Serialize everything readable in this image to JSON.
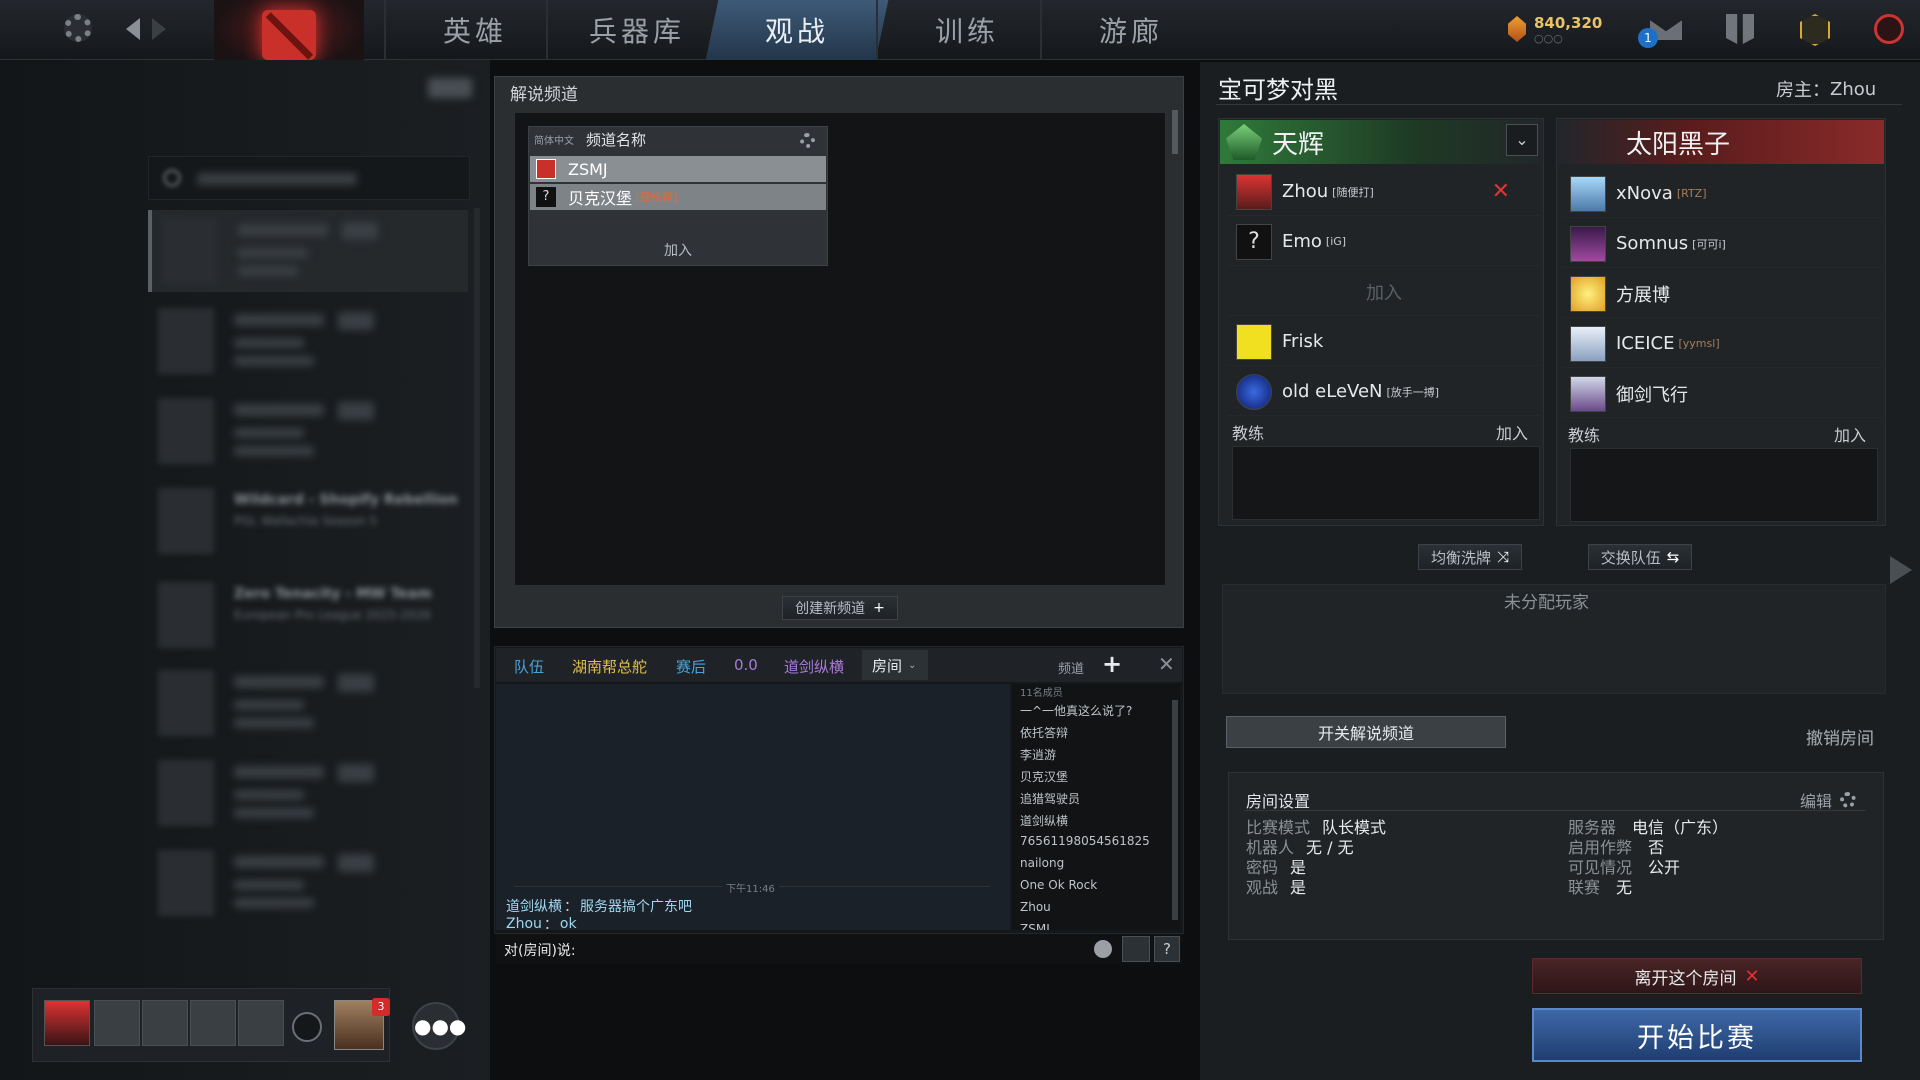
{
  "topbar": {
    "tabs": [
      "英雄",
      "兵器库",
      "观战",
      "训练",
      "游廊"
    ],
    "active_tab": "观战",
    "currency": "840,320",
    "currency_sub": "○○○",
    "notif_count": "1"
  },
  "left_panel": {
    "toggle_label": "▮▮",
    "search_placeholder": "",
    "blurred_title_1": "Wildcard - Shopify Rebellion",
    "blurred_sub_1": "PGL Wallachia Season 5",
    "blurred_title_2": "Zero Tenacity - MW Team",
    "blurred_sub_2": "European Pro League 2025-2026"
  },
  "caster_channel": {
    "title": "解说频道",
    "lang_label": "简体中文",
    "col_header": "频道名称",
    "channels": [
      {
        "name": "ZSMJ",
        "tag": ""
      },
      {
        "name": "贝克汉堡",
        "tag": "[硬核帮]"
      }
    ],
    "join_label": "加入",
    "create_label": "创建新频道"
  },
  "chat": {
    "tabs": [
      "队伍",
      "湖南帮总舵",
      "赛后",
      "0.0",
      "道剑纵横",
      "房间"
    ],
    "channel_label": "频道",
    "member_count": "11名成员",
    "members": [
      "一^一他真这么说了?",
      "依托答辩",
      "李逍游",
      "贝克汉堡",
      "追猎驾驶员",
      "道剑纵横",
      "76561198054561825",
      "nailong",
      "One Ok Rock",
      "Zhou",
      "ZSMJ"
    ],
    "time": "下午11:46",
    "messages": [
      {
        "from": "道剑纵横",
        "sep": "：",
        "text": "服务器搞个广东吧"
      },
      {
        "from": "Zhou",
        "sep": "：",
        "text": "ok"
      }
    ],
    "input_label": "对(房间)说:",
    "help": "?"
  },
  "lobby": {
    "title": "宝可梦对黑",
    "host_label": "房主：",
    "host": "Zhou",
    "radiant": {
      "name": "天辉",
      "players": [
        {
          "name": "Zhou",
          "tag": "[随便打]"
        },
        {
          "name": "Emo",
          "tag": "[iG]"
        },
        {
          "name": "加入",
          "tag": ""
        },
        {
          "name": "Frisk",
          "tag": ""
        },
        {
          "name": "old eLeVeN",
          "tag": "[放手一搏]"
        }
      ],
      "coach_label": "教练",
      "coach_join": "加入"
    },
    "dire": {
      "name": "太阳黑子",
      "players": [
        {
          "name": "xNova",
          "tag": "[RTZ]"
        },
        {
          "name": "Somnus",
          "tag": "[可可i]"
        },
        {
          "name": "方展博",
          "tag": ""
        },
        {
          "name": "ICEICE",
          "tag": "[yymsl]"
        },
        {
          "name": "御剑飞行",
          "tag": ""
        }
      ],
      "coach_label": "教练",
      "coach_join": "加入"
    },
    "shuffle_label": "均衡洗牌",
    "swap_label": "交换队伍",
    "unassigned_label": "未分配玩家",
    "caster_toggle": "开关解说频道",
    "cancel_label": "撤销房间",
    "settings": {
      "title": "房间设置",
      "edit_label": "编辑",
      "left": [
        {
          "k": "比赛模式",
          "v": "队长模式"
        },
        {
          "k": "机器人",
          "v": "无 / 无"
        },
        {
          "k": "密码",
          "v": "是"
        },
        {
          "k": "观战",
          "v": "是"
        }
      ],
      "right": [
        {
          "k": "服务器",
          "v": "电信（广东）"
        },
        {
          "k": "启用作弊",
          "v": "否"
        },
        {
          "k": "可见情况",
          "v": "公开"
        },
        {
          "k": "联赛",
          "v": "无"
        }
      ]
    },
    "leave_label": "离开这个房间",
    "start_label": "开始比赛"
  },
  "party": {
    "badge": "3"
  },
  "colors": {
    "radiant": "#2f8f3a",
    "dire": "#8a2a2a",
    "accent": "#3c6fb0"
  }
}
